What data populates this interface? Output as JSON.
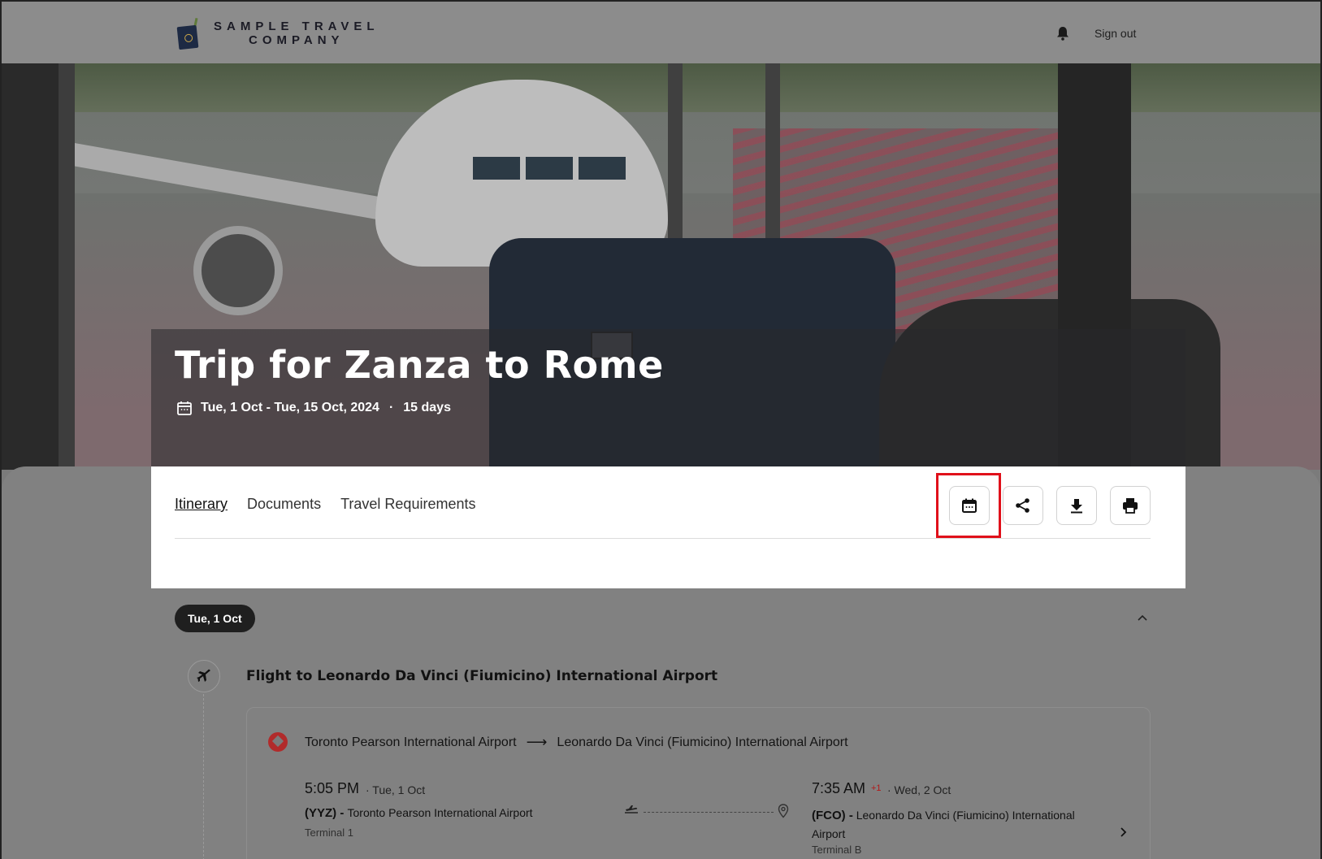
{
  "header": {
    "logo_line1": "SAMPLE TRAVEL",
    "logo_line2": "COMPANY",
    "notifications_icon": "bell-icon",
    "signout_label": "Sign out"
  },
  "trip": {
    "title": "Trip for Zanza to Rome",
    "date_range": "Tue, 1 Oct - Tue, 15 Oct, 2024",
    "separator": "·",
    "duration": "15 days"
  },
  "tabs": [
    {
      "label": "Itinerary",
      "active": true
    },
    {
      "label": "Documents",
      "active": false
    },
    {
      "label": "Travel Requirements",
      "active": false
    }
  ],
  "actions": {
    "calendar_icon": "calendar-icon",
    "share_icon": "share-icon",
    "download_icon": "download-icon",
    "print_icon": "print-icon"
  },
  "day": {
    "label": "Tue, 1 Oct",
    "collapse_glyph": "^"
  },
  "flight": {
    "title": "Flight to Leonardo Da Vinci (Fiumicino) International Airport",
    "origin": "Toronto Pearson International Airport",
    "destination": "Leonardo Da Vinci (Fiumicino) International Airport",
    "route_arrow": "⟶",
    "departure": {
      "time": "5:05 PM",
      "date": "· Tue, 1 Oct",
      "code": "(YYZ) -",
      "airport": "Toronto Pearson International Airport",
      "terminal": "Terminal 1"
    },
    "arrival": {
      "time": "7:35 AM",
      "day_offset": "+1",
      "date": "· Wed, 2 Oct",
      "code": "(FCO) -",
      "airport": "Leonardo Da Vinci (Fiumicino) International Airport",
      "terminal": "Terminal B"
    }
  },
  "colors": {
    "highlight": "#e0101a",
    "day_pill": "#1f1f1f",
    "day_offset": "#b31717"
  }
}
